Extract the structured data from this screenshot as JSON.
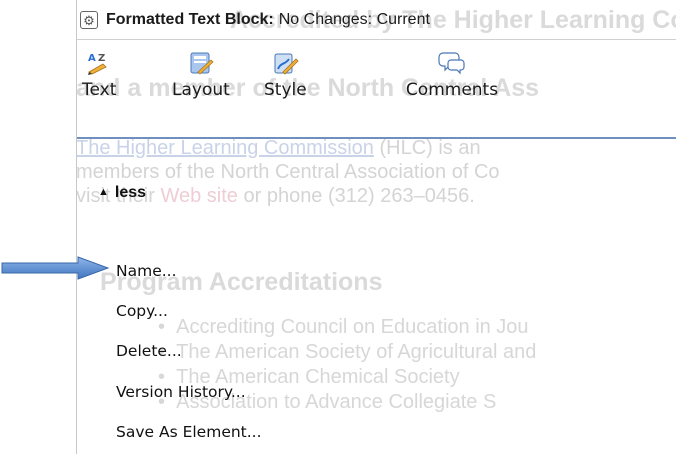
{
  "background": {
    "heading1": "Accredited by The Higher Learning Co",
    "heading2": "and a member of the North Central Ass",
    "para_link1": "The Higher Learning Commission",
    "para_line1_rest": " (HLC) is an",
    "para_line2": "members of the North Central Association of Co",
    "para_line3_a": "visit their ",
    "para_line3_link": "Web site",
    "para_line3_b": " or phone (312) 263–0456.",
    "heading3": "Program Accreditations",
    "bullets": [
      "Accrediting Council on Education in Jou",
      "The American Society of Agricultural and",
      "The American Chemical Society",
      "Association to Advance Collegiate S"
    ]
  },
  "titlebar": {
    "label": "Formatted Text Block:",
    "status": "No Changes: Current"
  },
  "toolbar": {
    "text_label": "Text",
    "layout_label": "Layout",
    "style_label": "Style",
    "comments_label": "Comments"
  },
  "toggle": {
    "label": "less"
  },
  "menu": {
    "items": [
      "Name...",
      "Copy...",
      "Delete...",
      "Version History...",
      "Save As Element..."
    ]
  },
  "colors": {
    "accent_arrow": "#5b8fd4",
    "rule": "#6f8fbf"
  }
}
